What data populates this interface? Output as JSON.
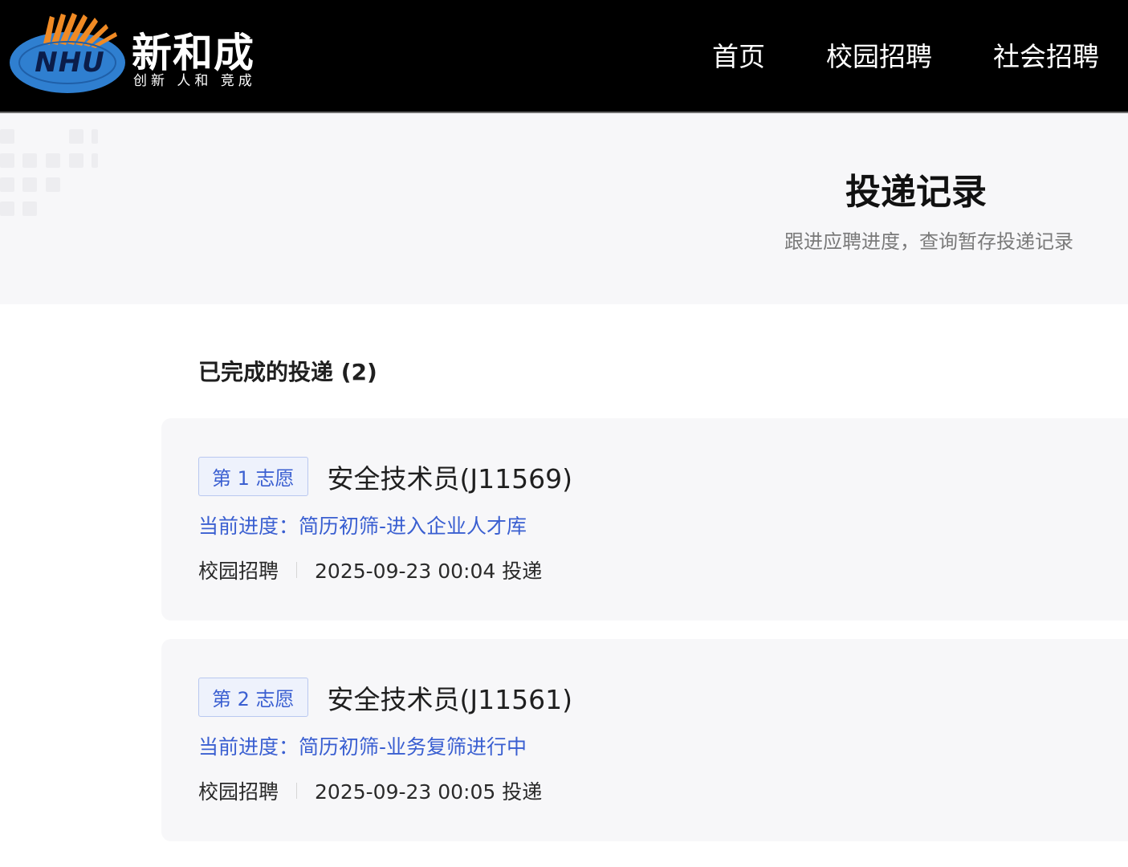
{
  "header": {
    "logo_mark": "NHU",
    "brand_name": "新和成",
    "brand_slogan": "创新 人和 竞成",
    "nav": [
      {
        "label": "首页"
      },
      {
        "label": "校园招聘"
      },
      {
        "label": "社会招聘"
      }
    ]
  },
  "banner": {
    "title": "投递记录",
    "subtitle": "跟进应聘进度，查询暂存投递记录"
  },
  "section": {
    "title": "已完成的投递 (2)"
  },
  "applications": [
    {
      "preference": "第 1 志愿",
      "job_title": "安全技术员(J11569)",
      "progress": "当前进度：简历初筛-进入企业人才库",
      "channel": "校园招聘",
      "time": "2025-09-23 00:04 投递"
    },
    {
      "preference": "第 2 志愿",
      "job_title": "安全技术员(J11561)",
      "progress": "当前进度：简历初筛-业务复筛进行中",
      "channel": "校园招聘",
      "time": "2025-09-23 00:05 投递"
    }
  ],
  "colors": {
    "header_bg": "#000000",
    "accent_blue": "#3a5fd1",
    "card_bg": "#f7f7f9",
    "logo_blue": "#2f7fd0",
    "logo_orange": "#f08a24"
  }
}
